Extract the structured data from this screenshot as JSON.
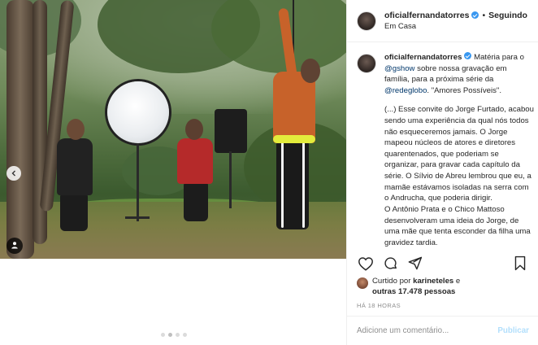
{
  "header": {
    "username": "oficialfernandatorres",
    "separator": "•",
    "follow_label": "Seguindo",
    "location": "Em Casa"
  },
  "caption": {
    "username": "oficialfernandatorres",
    "intro": "Matéria para o ",
    "mention_gshow": "@gshow",
    "intro2": " sobre nossa gravação em família, para a próxima série da ",
    "mention_redeglobo": "@redeglobo",
    "intro3": ". \"Amores Possíveis\".",
    "para1": "(...) Esse convite do Jorge Furtado, acabou sendo uma experiência da qual nós todos não esqueceremos jamais. O Jorge mapeou núcleos de atores e diretores quarentenados, que poderiam se organizar, para gravar cada capítulo da série. O Sílvio de Abreu lembrou que eu, a mamãe estávamos isoladas na serra com o Andrucha, que poderia dirigir.",
    "para2": "O Antônio Prata e o Chico Mattoso desenvolveram uma ideia do Jorge, de uma mãe que tenta esconder da filha uma gravidez tardia."
  },
  "likes": {
    "prefix": "Curtido por ",
    "first_user": "karineteles",
    "joiner": " e",
    "others": "outras 17.478 pessoas"
  },
  "timestamp": "HÁ 18 HORAS",
  "comment": {
    "placeholder": "Adicione um comentário...",
    "publish_label": "Publicar"
  },
  "carousel": {
    "total": 4,
    "active": 2
  },
  "colors": {
    "verified": "#3897f0",
    "link": "#00376b",
    "publish_disabled": "#b2dffc",
    "muted": "#8e8e8e"
  },
  "icons": [
    "heart-icon",
    "comment-icon",
    "share-icon",
    "bookmark-icon",
    "chevron-left-icon",
    "user-tag-icon",
    "verified-icon"
  ]
}
